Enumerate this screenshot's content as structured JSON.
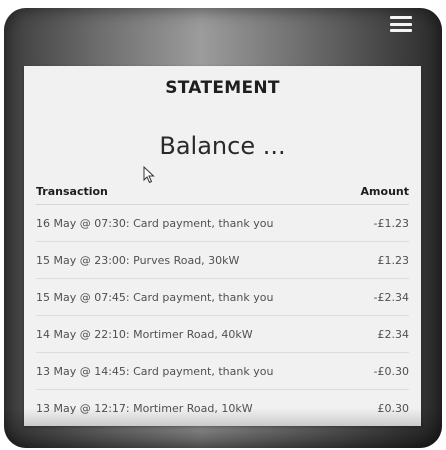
{
  "header": {
    "menu_icon": "hamburger-menu-icon"
  },
  "statement": {
    "title": "STATEMENT",
    "balance": "Balance ...",
    "columns": {
      "transaction": "Transaction",
      "amount": "Amount"
    },
    "rows": [
      {
        "description": "16 May @ 07:30: Card payment, thank you",
        "amount": "-£1.23"
      },
      {
        "description": "15 May @ 23:00: Purves Road, 30kW",
        "amount": "£1.23"
      },
      {
        "description": "15 May @ 07:45: Card payment, thank you",
        "amount": "-£2.34"
      },
      {
        "description": "14 May @ 22:10: Mortimer Road, 40kW",
        "amount": "£2.34"
      },
      {
        "description": "13 May @ 14:45: Card payment, thank you",
        "amount": "-£0.30"
      },
      {
        "description": "13 May @ 12:17: Mortimer Road, 10kW",
        "amount": "£0.30"
      }
    ]
  }
}
